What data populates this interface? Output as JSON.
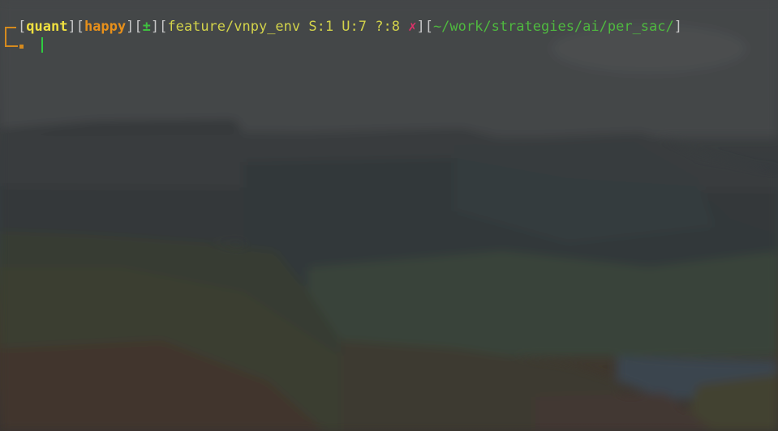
{
  "prompt": {
    "user": "quant",
    "mood": "happy",
    "pm_symbol": "±",
    "branch_status": "feature/vnpy_env S:1 U:7 ?:8 ",
    "dirty_mark": "✗",
    "path": "~/work/strategies/ai/per_sac/"
  },
  "colors": {
    "accent_orange": "#d58a1e",
    "user_yellow": "#f0e040",
    "branch_yellow": "#d2d24a",
    "path_green": "#4fb93f",
    "dirty_red": "#e0306a",
    "cursor_green": "#2ecc40"
  }
}
